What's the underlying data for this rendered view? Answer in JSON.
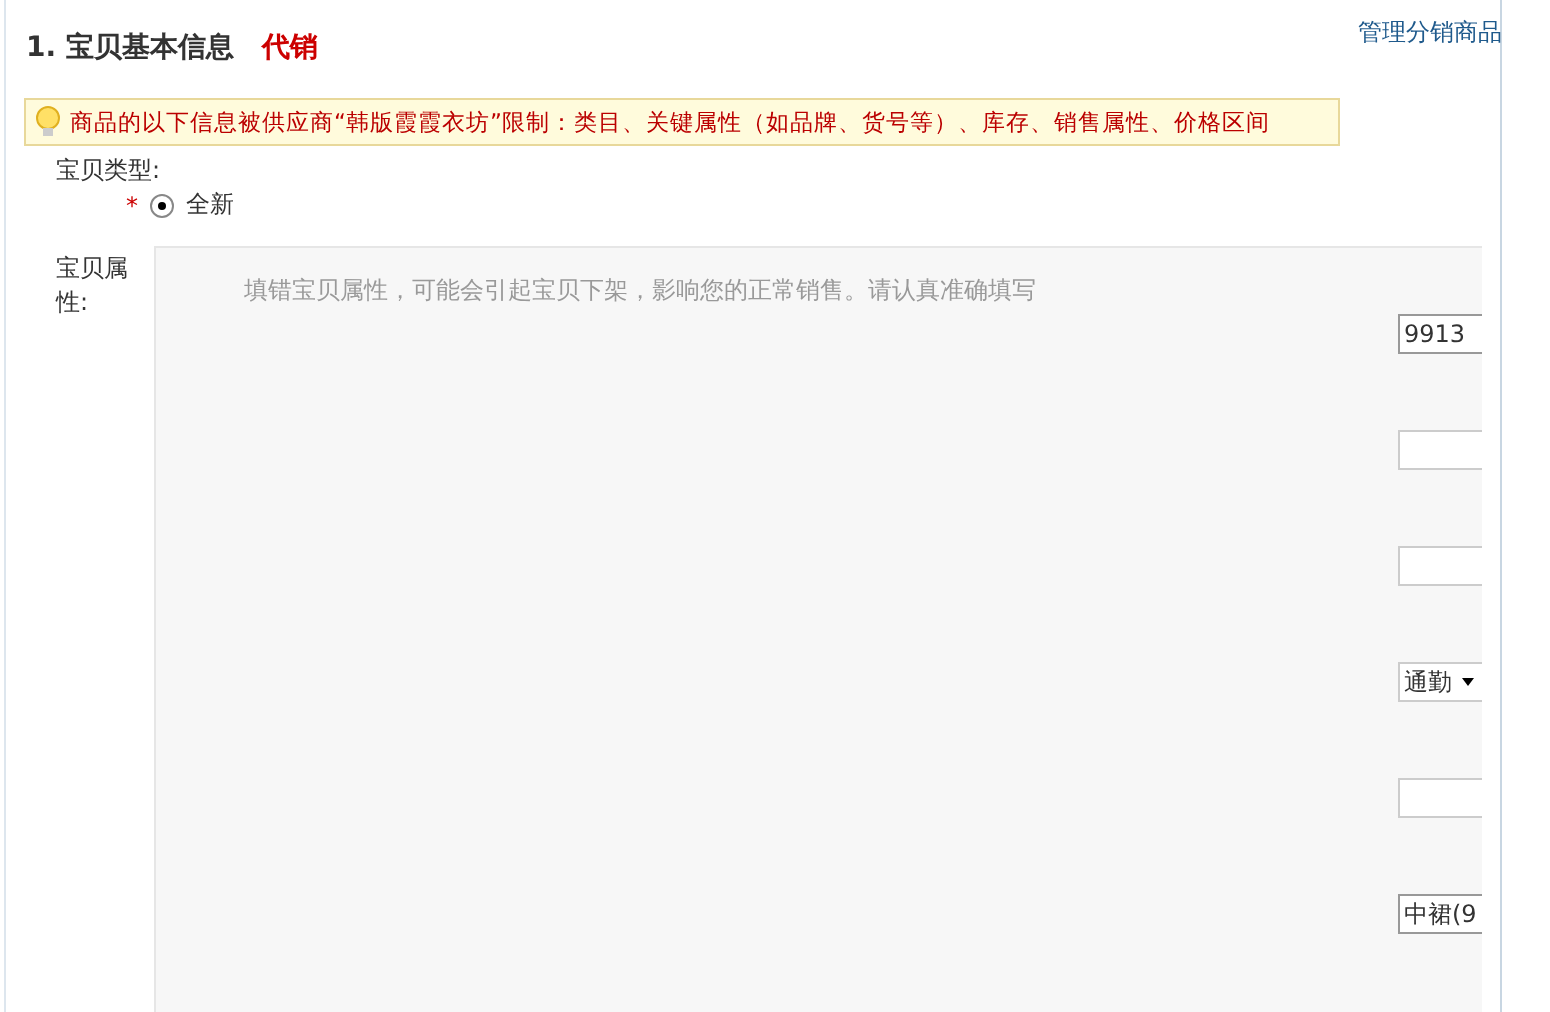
{
  "heading": {
    "number": "1.",
    "title": "宝贝基本信息",
    "tag": "代销"
  },
  "manage_link": "管理分销商品",
  "notice": "商品的以下信息被供应商“韩版霞霞衣坊”限制：类目、关键属性（如品牌、货号等）、库存、销售属性、价格区间",
  "item_type": {
    "label": "宝贝类型:",
    "required": "*",
    "options": [
      {
        "label": "全新",
        "selected": true
      }
    ]
  },
  "attributes": {
    "label": "宝贝属性:",
    "hint": "填错宝贝属性，可能会引起宝贝下架，影响您的正常销售。请认真准确填写",
    "fields": [
      {
        "kind": "input",
        "value": "9913"
      },
      {
        "kind": "input"
      },
      {
        "kind": "input"
      },
      {
        "kind": "select",
        "value": "通勤"
      },
      {
        "kind": "input"
      },
      {
        "kind": "input",
        "value": "中裙(9"
      }
    ]
  }
}
